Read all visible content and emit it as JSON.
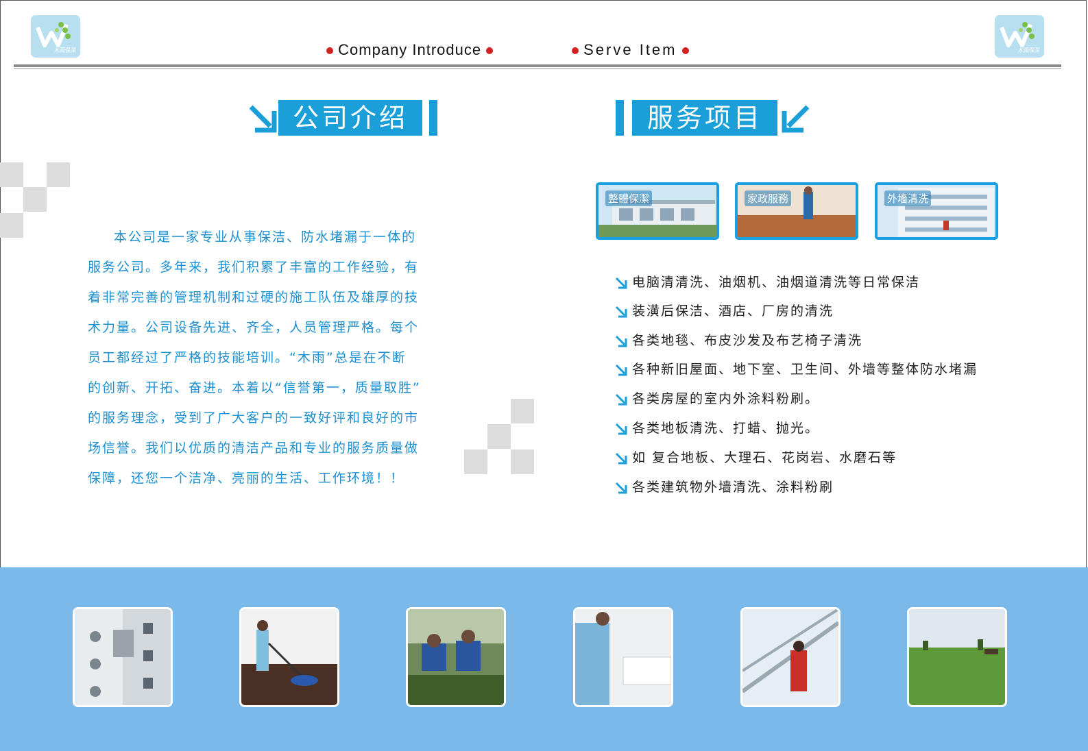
{
  "header": {
    "logo_text": "木雨保潔",
    "nav": [
      "Company Introduce",
      "Serve Item"
    ]
  },
  "headings": {
    "company_intro": "公司介绍",
    "services": "服务项目"
  },
  "intro_lines": [
    "本公司是一家专业从事保洁、防水堵漏于一体的",
    "服务公司。多年来，我们积累了丰富的工作经验，有",
    "着非常完善的管理机制和过硬的施工队伍及雄厚的技",
    "术力量。公司设备先进、齐全，人员管理严格。每个",
    "员工都经过了严格的技能培训。“木雨”总是在不断",
    "的创新、开拓、奋进。本着以“信誉第一，质量取胜”",
    "的服务理念，受到了广大客户的一致好评和良好的市",
    "场信誉。我们以优质的清洁产品和专业的服务质量做",
    "保障，还您一个洁净、亮丽的生活、工作环境！！"
  ],
  "service_thumbs": [
    "整體保潔",
    "家政服務",
    "外墻清洗"
  ],
  "services": [
    "电脑清清洗、油烟机、油烟道清洗等日常保洁",
    "装潢后保洁、酒店、厂房的清洗",
    "各类地毯、布皮沙发及布艺椅子清洗",
    "各种新旧屋面、地下室、卫生间、外墙等整体防水堵漏",
    "各类房屋的室内外涂料粉刷。",
    "各类地板清洗、打蜡、抛光。",
    "如 复合地板、大理石、花岗岩、水磨石等",
    "各类建筑物外墙清洗、涂料粉刷"
  ],
  "colors": {
    "accent": "#1a9fd8",
    "intro_text": "#1c8fd0",
    "band": "#7ab9ea",
    "nav_dot": "#d32020"
  }
}
